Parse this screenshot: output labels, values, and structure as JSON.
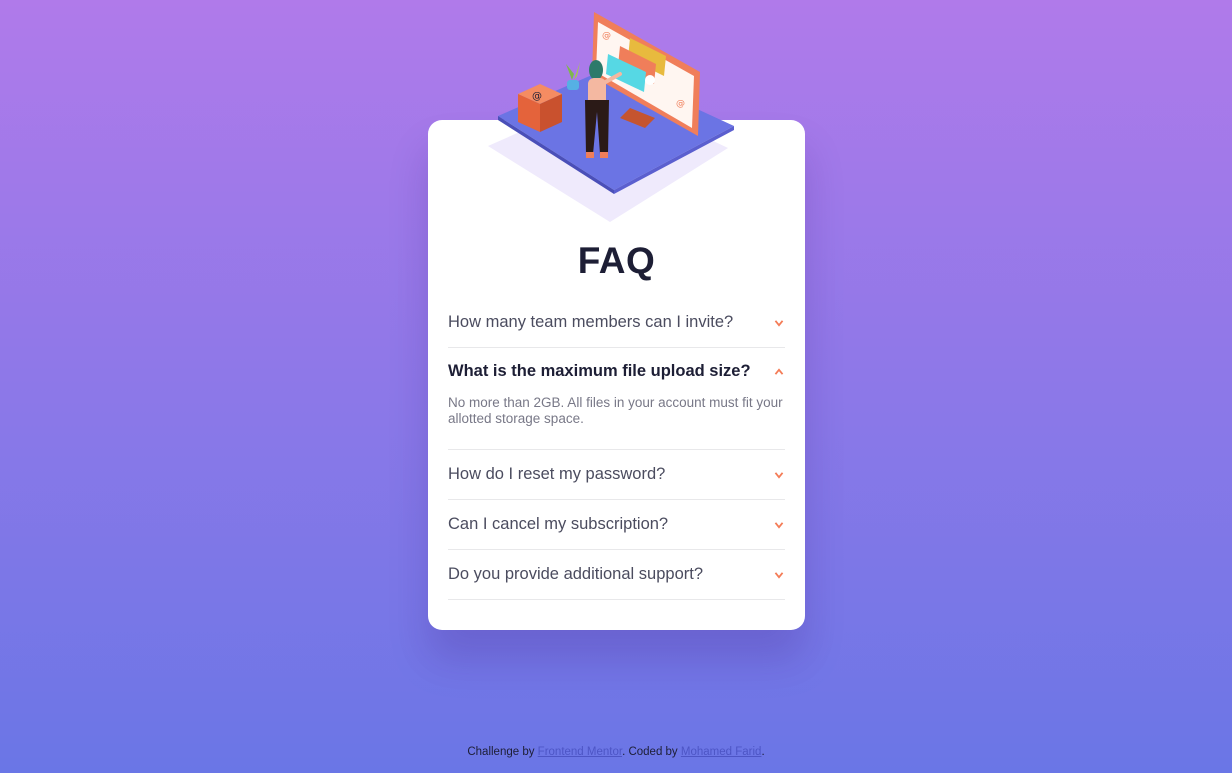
{
  "title": "FAQ",
  "faq": [
    {
      "question": "How many team members can I invite?",
      "answer": "",
      "open": false
    },
    {
      "question": "What is the maximum file upload size?",
      "answer": "No more than 2GB. All files in your account must fit your allotted storage space.",
      "open": true
    },
    {
      "question": "How do I reset my password?",
      "answer": "",
      "open": false
    },
    {
      "question": "Can I cancel my subscription?",
      "answer": "",
      "open": false
    },
    {
      "question": "Do you provide additional support?",
      "answer": "",
      "open": false
    }
  ],
  "footer": {
    "prefix": "Challenge by ",
    "link1": "Frontend Mentor",
    "middle": ". Coded by ",
    "link2": "Mohamed Farid",
    "suffix": "."
  },
  "icons": {
    "collapsed": "chevron-down-icon",
    "expanded": "chevron-up-icon"
  },
  "colors": {
    "accent": "#f47c57",
    "heading": "#1d1e35",
    "text": "#4b4c5f",
    "answer": "#787887",
    "bg_top": "#b07aea",
    "bg_bottom": "#6a76e6"
  }
}
